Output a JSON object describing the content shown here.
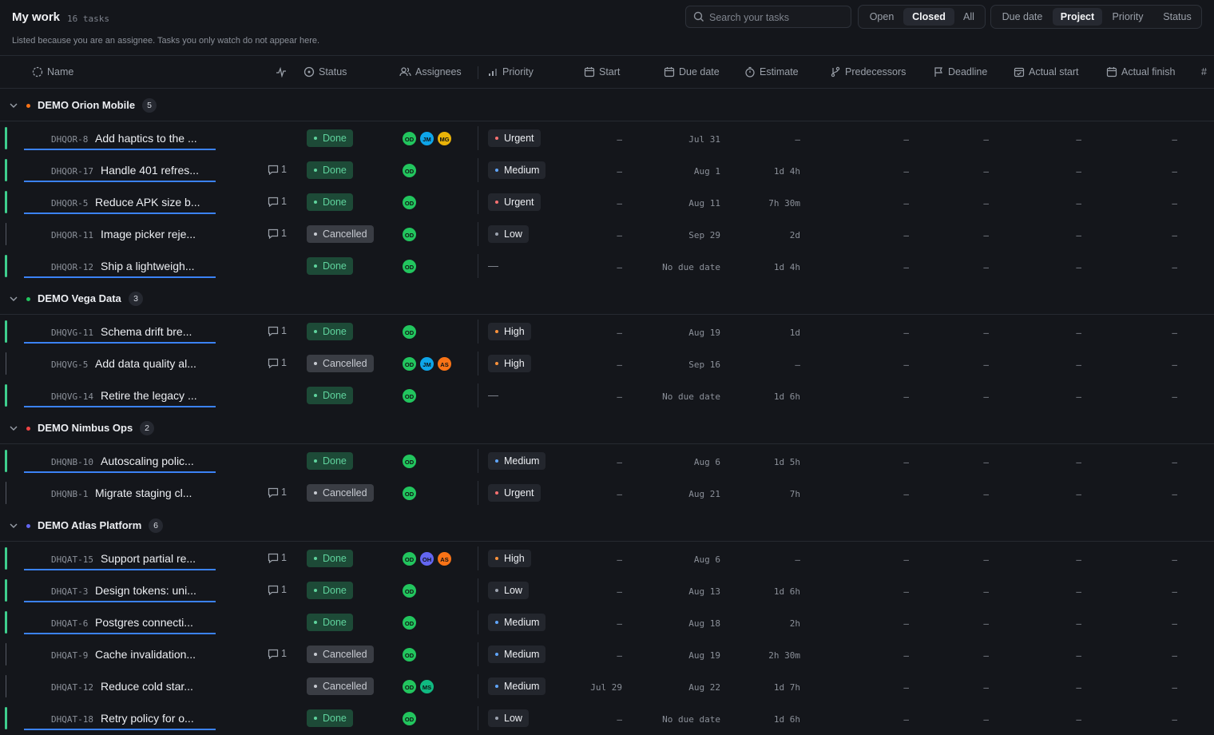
{
  "header": {
    "title": "My work",
    "task_count": "16 tasks",
    "subtitle": "Listed because you are an assignee. Tasks you only watch do not appear here.",
    "search_placeholder": "Search your tasks",
    "state_filter": {
      "options": [
        "Open",
        "Closed",
        "All"
      ],
      "selected": "Closed"
    },
    "group_by": {
      "options": [
        "Due date",
        "Project",
        "Priority",
        "Status"
      ],
      "selected": "Project"
    }
  },
  "columns": [
    "Name",
    "Status",
    "Assignees",
    "Priority",
    "Start",
    "Due date",
    "Estimate",
    "Predecessors",
    "Deadline",
    "Actual start",
    "Actual finish",
    "#"
  ],
  "colors": {
    "accent": "#3b82f6",
    "done": "#3ecf8e",
    "urgent": "#f87171",
    "high": "#fb923c",
    "medium": "#60a5fa",
    "low": "#9ca3af"
  },
  "empty_value": "–",
  "priority_empty": "—",
  "groups": [
    {
      "name": "DEMO Orion Mobile",
      "count": "5",
      "color": "#f97316",
      "tasks": [
        {
          "id": "DHQOR-8",
          "name": "Add haptics to the ...",
          "comments": "",
          "status": "Done",
          "assignees": [
            "OD",
            "JM",
            "MG"
          ],
          "priority": "Urgent",
          "start": "–",
          "due": "Jul 31",
          "estimate": "–"
        },
        {
          "id": "DHQOR-17",
          "name": "Handle 401 refres...",
          "comments": "1",
          "status": "Done",
          "assignees": [
            "OD"
          ],
          "priority": "Medium",
          "start": "–",
          "due": "Aug 1",
          "estimate": "1d 4h"
        },
        {
          "id": "DHQOR-5",
          "name": "Reduce APK size b...",
          "comments": "1",
          "status": "Done",
          "assignees": [
            "OD"
          ],
          "priority": "Urgent",
          "start": "–",
          "due": "Aug 11",
          "estimate": "7h 30m"
        },
        {
          "id": "DHQOR-11",
          "name": "Image picker reje...",
          "comments": "1",
          "status": "Cancelled",
          "assignees": [
            "OD"
          ],
          "priority": "Low",
          "start": "–",
          "due": "Sep 29",
          "estimate": "2d"
        },
        {
          "id": "DHQOR-12",
          "name": "Ship a lightweigh...",
          "comments": "",
          "status": "Done",
          "assignees": [
            "OD"
          ],
          "priority": "",
          "start": "–",
          "due": "No due date",
          "estimate": "1d 4h"
        }
      ]
    },
    {
      "name": "DEMO Vega Data",
      "count": "3",
      "color": "#22c55e",
      "tasks": [
        {
          "id": "DHQVG-11",
          "name": "Schema drift bre...",
          "comments": "1",
          "status": "Done",
          "assignees": [
            "OD"
          ],
          "priority": "High",
          "start": "–",
          "due": "Aug 19",
          "estimate": "1d"
        },
        {
          "id": "DHQVG-5",
          "name": "Add data quality al...",
          "comments": "1",
          "status": "Cancelled",
          "assignees": [
            "OD",
            "JM",
            "AS"
          ],
          "priority": "High",
          "start": "–",
          "due": "Sep 16",
          "estimate": "–"
        },
        {
          "id": "DHQVG-14",
          "name": "Retire the legacy ...",
          "comments": "",
          "status": "Done",
          "assignees": [
            "OD"
          ],
          "priority": "",
          "start": "–",
          "due": "No due date",
          "estimate": "1d 6h"
        }
      ]
    },
    {
      "name": "DEMO Nimbus Ops",
      "count": "2",
      "color": "#ef4444",
      "tasks": [
        {
          "id": "DHQNB-10",
          "name": "Autoscaling polic...",
          "comments": "",
          "status": "Done",
          "assignees": [
            "OD"
          ],
          "priority": "Medium",
          "start": "–",
          "due": "Aug 6",
          "estimate": "1d 5h"
        },
        {
          "id": "DHQNB-1",
          "name": "Migrate staging cl...",
          "comments": "1",
          "status": "Cancelled",
          "assignees": [
            "OD"
          ],
          "priority": "Urgent",
          "start": "–",
          "due": "Aug 21",
          "estimate": "7h"
        }
      ]
    },
    {
      "name": "DEMO Atlas Platform",
      "count": "6",
      "color": "#6366f1",
      "tasks": [
        {
          "id": "DHQAT-15",
          "name": "Support partial re...",
          "comments": "1",
          "status": "Done",
          "assignees": [
            "OD",
            "OH",
            "AS"
          ],
          "priority": "High",
          "start": "–",
          "due": "Aug 6",
          "estimate": "–"
        },
        {
          "id": "DHQAT-3",
          "name": "Design tokens: uni...",
          "comments": "1",
          "status": "Done",
          "assignees": [
            "OD"
          ],
          "priority": "Low",
          "start": "–",
          "due": "Aug 13",
          "estimate": "1d 6h"
        },
        {
          "id": "DHQAT-6",
          "name": "Postgres connecti...",
          "comments": "",
          "status": "Done",
          "assignees": [
            "OD"
          ],
          "priority": "Medium",
          "start": "–",
          "due": "Aug 18",
          "estimate": "2h"
        },
        {
          "id": "DHQAT-9",
          "name": "Cache invalidation...",
          "comments": "1",
          "status": "Cancelled",
          "assignees": [
            "OD"
          ],
          "priority": "Medium",
          "start": "–",
          "due": "Aug 19",
          "estimate": "2h 30m"
        },
        {
          "id": "DHQAT-12",
          "name": "Reduce cold star...",
          "comments": "",
          "status": "Cancelled",
          "assignees": [
            "OD",
            "MS"
          ],
          "priority": "Medium",
          "start": "Jul 29",
          "due": "Aug 22",
          "estimate": "1d 7h"
        },
        {
          "id": "DHQAT-18",
          "name": "Retry policy for o...",
          "comments": "",
          "status": "Done",
          "assignees": [
            "OD"
          ],
          "priority": "Low",
          "start": "–",
          "due": "No due date",
          "estimate": "1d 6h"
        }
      ]
    }
  ],
  "avatar_colors": {
    "OD": "#22c55e",
    "JM": "#0ea5e9",
    "MG": "#eab308",
    "AS": "#f97316",
    "OH": "#6366f1",
    "MS": "#10b981"
  }
}
